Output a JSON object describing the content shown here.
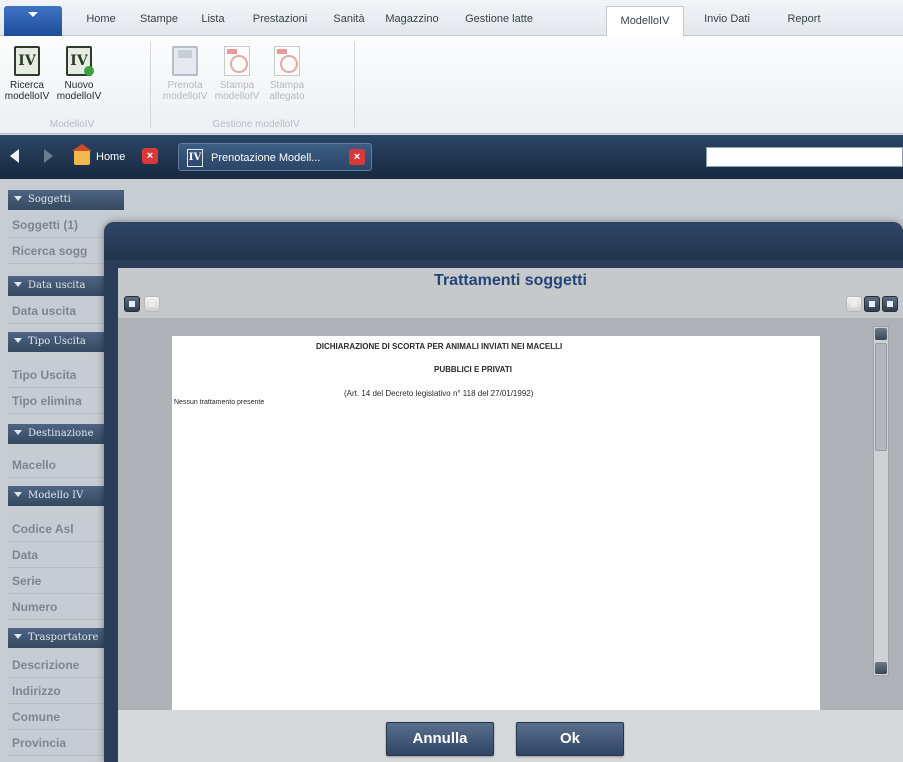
{
  "ribbon": {
    "tabs": [
      "Home",
      "Stampe",
      "Lista",
      "Prestazioni",
      "Sanità",
      "Magazzino",
      "Gestione latte",
      "ModelloIV",
      "Invio Dati",
      "Report"
    ],
    "active_tab": "ModelloIV",
    "buttons": [
      {
        "line1": "Ricerca",
        "line2": "modelloIV",
        "icon": "modello-iv-search-icon"
      },
      {
        "line1": "Nuovo",
        "line2": "modelloIV",
        "icon": "modello-iv-new-icon"
      },
      {
        "line1": "Prenota",
        "line2": "modelloIV",
        "icon": "floppy-disk-icon"
      },
      {
        "line1": "Stampa",
        "line2": "modelloIV",
        "icon": "pdf-icon"
      },
      {
        "line1": "Stampa",
        "line2": "allegato",
        "icon": "pdf-icon"
      }
    ],
    "groups": [
      "ModelloIV",
      "Gestione modelloIV"
    ]
  },
  "doc_tabs": {
    "home": "Home",
    "prenotazione": "Prenotazione Modell..."
  },
  "sidebar": {
    "sections": [
      {
        "title": "Soggetti",
        "fields": [
          "Soggetti (1)",
          "Ricerca sogg"
        ]
      },
      {
        "title": "Data uscita",
        "fields": [
          "Data uscita"
        ]
      },
      {
        "title": "Tipo Uscita",
        "fields": [
          "Tipo Uscita",
          "Tipo elimina"
        ]
      },
      {
        "title": "Destinazione",
        "fields": [
          "Macello"
        ]
      },
      {
        "title": "Modello IV",
        "fields": [
          "Codice Asl",
          "Data",
          "Serie",
          "Numero"
        ]
      },
      {
        "title": "Trasportatore",
        "fields": [
          "Descrizione",
          "Indirizzo",
          "Comune",
          "Provincia"
        ]
      }
    ]
  },
  "modal": {
    "title": "Trattamenti soggetti",
    "document": {
      "heading1": "DICHIARAZIONE DI SCORTA PER ANIMALI INVIATI NEI MACELLI",
      "heading2": "PUBBLICI E PRIVATI",
      "reference": "(Art. 14 del Decreto legislativo n° 118 del 27/01/1992)",
      "empty_text": "Nessun trattamento presente"
    },
    "cancel_label": "Annulla",
    "ok_label": "Ok"
  },
  "colors": {
    "accent": "#22457a",
    "header_dark": "#2a3c58",
    "close_red": "#d83a3a"
  }
}
